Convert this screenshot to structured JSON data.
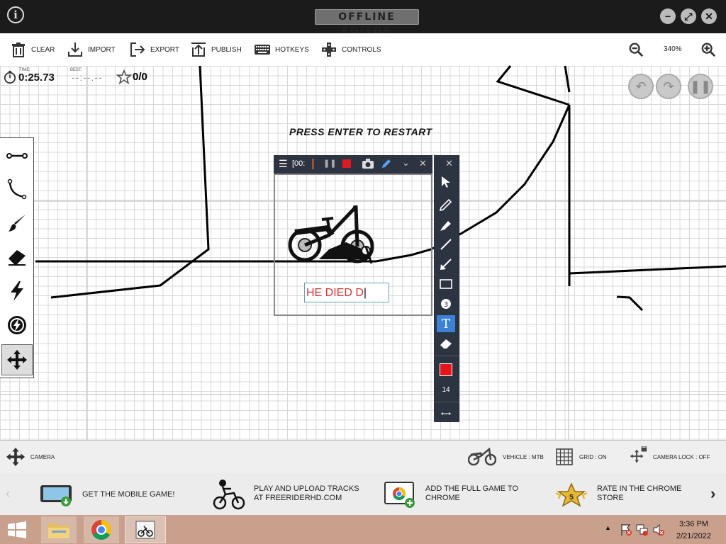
{
  "window": {
    "title": "OFFLINE EDITOR",
    "info_label": "i"
  },
  "toolbar": {
    "items": [
      {
        "label": "CLEAR",
        "icon": "trash-icon"
      },
      {
        "label": "IMPORT",
        "icon": "import-icon"
      },
      {
        "label": "EXPORT",
        "icon": "export-icon"
      },
      {
        "label": "PUBLISH",
        "icon": "publish-icon"
      },
      {
        "label": "HOTKEYS",
        "icon": "keyboard-icon"
      },
      {
        "label": "CONTROLS",
        "icon": "gamepad-icon"
      }
    ],
    "zoom": "340%"
  },
  "hud": {
    "time_label": "TIME:",
    "time": "0:25.73",
    "best_label": "BEST:",
    "best": "--:--.--",
    "stars": "0/0",
    "message": "PRESS ENTER TO RESTART"
  },
  "recorder": {
    "time_text": "[00:"
  },
  "textbox": {
    "value": "HE DIED D"
  },
  "draw_tools": {
    "size": "14",
    "color": "#e8141a"
  },
  "bottombar": {
    "camera": "CAMERA",
    "vehicle": "VEHICLE : MTB",
    "grid": "GRID : ON",
    "camera_lock": "CAMERA LOCK : OFF"
  },
  "promo": [
    {
      "text": "GET THE MOBILE GAME!"
    },
    {
      "text": "PLAY AND UPLOAD TRACKS\nAT FREERIDERHD.COM"
    },
    {
      "text": "ADD THE FULL GAME TO\nCHROME"
    },
    {
      "text": "RATE IN THE CHROME\nSTORE",
      "badge": "5"
    }
  ],
  "taskbar": {
    "time": "3:36 PM",
    "date": "2/21/2022"
  },
  "colors": {
    "titlebar": "#1b1b1b",
    "taskbar": "#c8a08c",
    "accent": "#3b82d6"
  }
}
